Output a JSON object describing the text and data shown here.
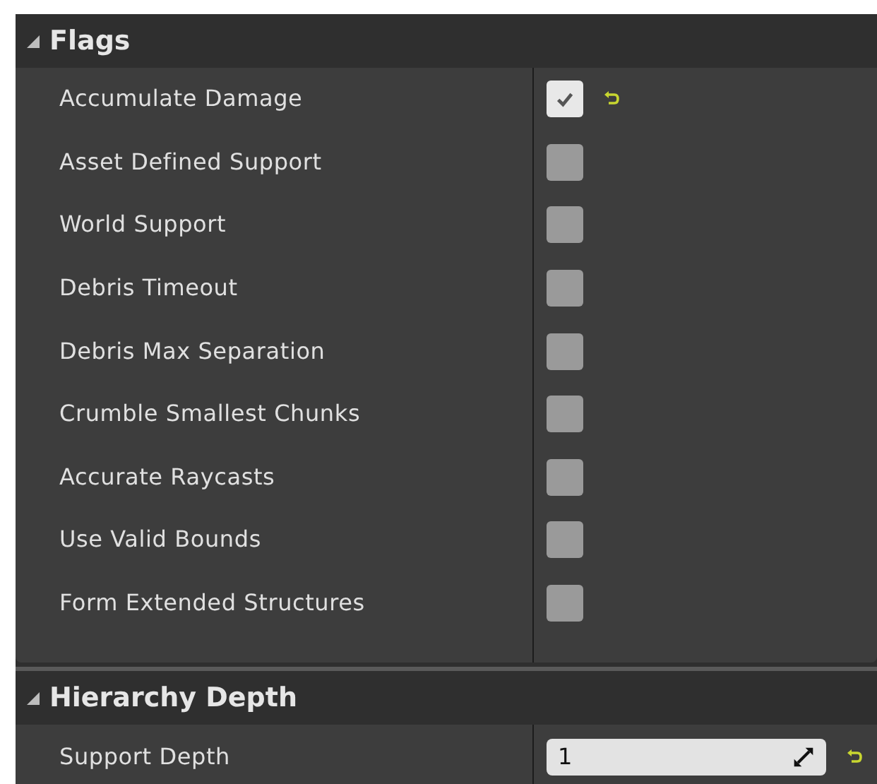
{
  "sections": [
    {
      "title": "Flags",
      "expanded": true,
      "rows": [
        {
          "label": "Accumulate Damage",
          "kind": "checkbox",
          "checked": true,
          "reset": true
        },
        {
          "label": "Asset Defined Support",
          "kind": "checkbox",
          "checked": false,
          "reset": false
        },
        {
          "label": "World Support",
          "kind": "checkbox",
          "checked": false,
          "reset": false
        },
        {
          "label": "Debris Timeout",
          "kind": "checkbox",
          "checked": false,
          "reset": false
        },
        {
          "label": "Debris Max Separation",
          "kind": "checkbox",
          "checked": false,
          "reset": false
        },
        {
          "label": "Crumble Smallest Chunks",
          "kind": "checkbox",
          "checked": false,
          "reset": false
        },
        {
          "label": "Accurate Raycasts",
          "kind": "checkbox",
          "checked": false,
          "reset": false
        },
        {
          "label": "Use Valid Bounds",
          "kind": "checkbox",
          "checked": false,
          "reset": false
        },
        {
          "label": "Form Extended Structures",
          "kind": "checkbox",
          "checked": false,
          "reset": false
        }
      ]
    },
    {
      "title": "Hierarchy Depth",
      "expanded": true,
      "rows": [
        {
          "label": "Support Depth",
          "kind": "number",
          "value": "1",
          "reset": true
        }
      ]
    }
  ]
}
